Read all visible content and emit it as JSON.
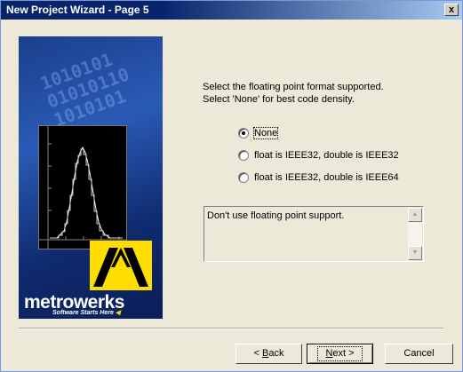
{
  "window": {
    "title": "New Project Wizard - Page  5",
    "close_symbol": "x"
  },
  "banner": {
    "binary_lines": [
      "1010101",
      "01010110",
      "1010101"
    ],
    "brand": "metrowerks",
    "tagline": "Software Starts Here"
  },
  "prompt": {
    "line1": "Select the floating point format supported.",
    "line2": "Select 'None' for best code density."
  },
  "options": [
    {
      "label": "None",
      "selected": true
    },
    {
      "label": "float is IEEE32, double is IEEE32",
      "selected": false
    },
    {
      "label": "float is IEEE32, double is IEEE64",
      "selected": false
    }
  ],
  "description": {
    "text": "Don't use floating point support."
  },
  "buttons": {
    "back_prefix": "< ",
    "back_key": "B",
    "back_rest": "ack",
    "next_key": "N",
    "next_rest": "ext >",
    "cancel": "Cancel"
  }
}
